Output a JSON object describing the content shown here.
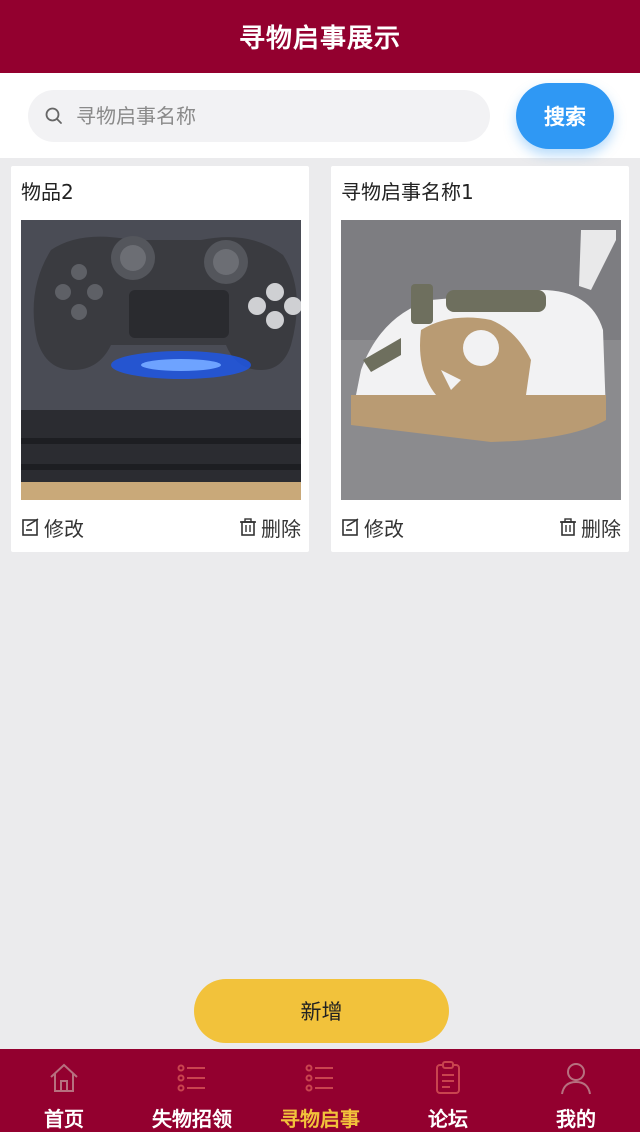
{
  "header": {
    "title": "寻物启事展示"
  },
  "search": {
    "placeholder": "寻物启事名称",
    "value": "",
    "button_label": "搜索"
  },
  "cards": [
    {
      "title": "物品2",
      "image": "game-controller-photo",
      "edit_label": "修改",
      "delete_label": "删除"
    },
    {
      "title": "寻物启事名称1",
      "image": "steam-iron-photo",
      "edit_label": "修改",
      "delete_label": "删除"
    }
  ],
  "add_button": {
    "label": "新增"
  },
  "tabbar": {
    "items": [
      {
        "label": "首页",
        "icon": "home-icon",
        "active": false
      },
      {
        "label": "失物招领",
        "icon": "list-icon",
        "active": false
      },
      {
        "label": "寻物启事",
        "icon": "list-icon",
        "active": true
      },
      {
        "label": "论坛",
        "icon": "clipboard-icon",
        "active": false
      },
      {
        "label": "我的",
        "icon": "user-icon",
        "active": false
      }
    ]
  },
  "colors": {
    "header_bg": "#93002f",
    "search_button": "#2f98f4",
    "add_button": "#f2c23b",
    "tab_active": "#f2c23b",
    "tab_icon_inactive": "#c9444f"
  }
}
